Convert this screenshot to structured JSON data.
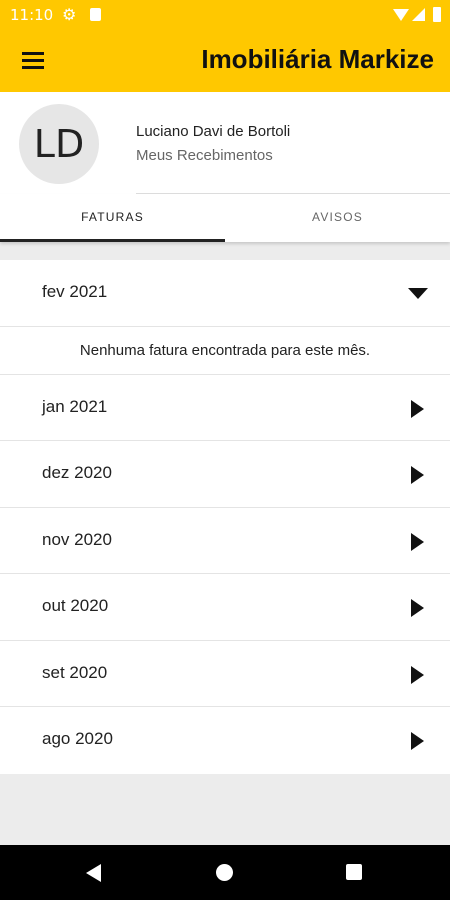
{
  "status_bar": {
    "time": "11:10",
    "icons": [
      "gear-icon",
      "sd-card-icon",
      "wifi-icon",
      "signal-icon",
      "battery-icon"
    ]
  },
  "app_bar": {
    "title": "Imobiliária Markize",
    "menu_icon": "hamburger-menu-icon"
  },
  "colors": {
    "primary": "#ffc800",
    "text": "#222222",
    "background": "#ececec"
  },
  "profile": {
    "initials": "LD",
    "name": "Luciano Davi de Bortoli",
    "subtitle": "Meus Recebimentos"
  },
  "tabs": [
    {
      "label": "FATURAS",
      "active": true
    },
    {
      "label": "AVISOS",
      "active": false
    }
  ],
  "months": {
    "expanded": {
      "label": "fev 2021",
      "empty_message": "Nenhuma fatura encontrada para este mês."
    },
    "items": [
      {
        "label": "jan 2021"
      },
      {
        "label": "dez 2020"
      },
      {
        "label": "nov 2020"
      },
      {
        "label": "out 2020"
      },
      {
        "label": "set 2020"
      },
      {
        "label": "ago 2020"
      }
    ]
  },
  "nav_bar": {
    "icons": [
      "back-icon",
      "home-icon",
      "recents-icon"
    ]
  }
}
